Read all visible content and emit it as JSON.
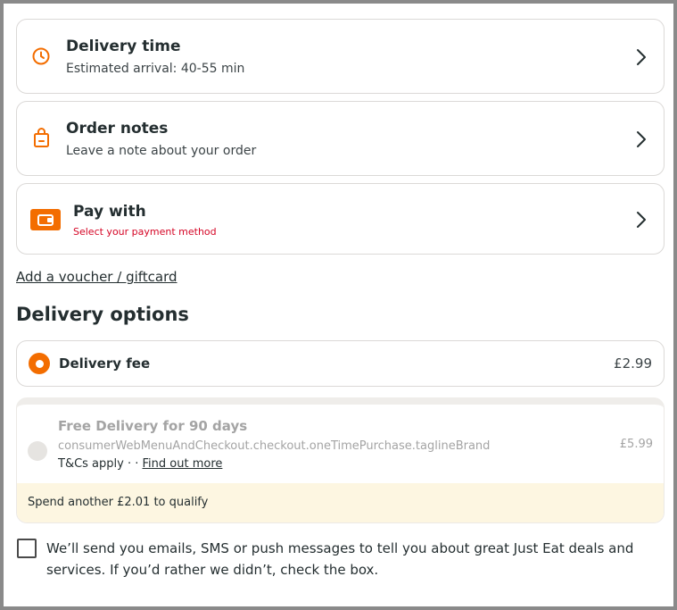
{
  "delivery_time": {
    "title": "Delivery time",
    "subtitle": "Estimated arrival: 40-55 min",
    "icon": "clock-icon"
  },
  "order_notes": {
    "title": "Order notes",
    "subtitle": "Leave a note about your order",
    "icon": "bag-icon"
  },
  "pay_with": {
    "title": "Pay with",
    "subtitle": "Select your payment method",
    "icon": "wallet-icon"
  },
  "voucher_link": "Add a voucher / giftcard",
  "delivery_options": {
    "heading": "Delivery options",
    "standard": {
      "label": "Delivery fee",
      "price": "£2.99",
      "selected": true
    },
    "promo": {
      "title": "Free Delivery for 90 days",
      "tagline": "consumerWebMenuAndCheckout.checkout.oneTimePurchase.taglineBrand",
      "tcs": "T&Cs apply · ·",
      "find_out_more": "Find out more",
      "price": "£5.99",
      "selected": false,
      "qualify_note": "Spend another £2.01 to qualify"
    }
  },
  "marketing_consent": {
    "checked": false,
    "text": "We’ll send you emails, SMS or push messages to tell you about great Just Eat deals and services. If you’d rather we didn’t, check the box."
  },
  "colors": {
    "accent": "#f36d00",
    "error": "#d50525",
    "promo_note_bg": "#fdf6e1"
  }
}
